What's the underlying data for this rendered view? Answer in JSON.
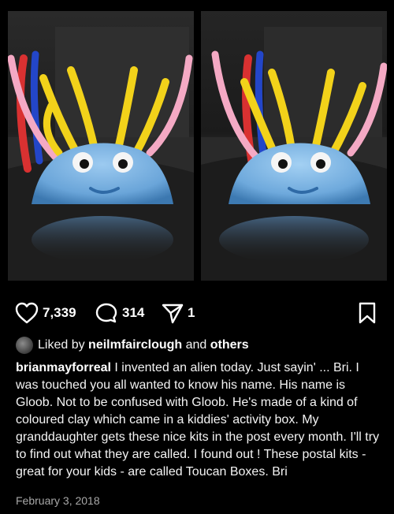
{
  "post": {
    "images": [
      {
        "alt": ""
      },
      {
        "alt": ""
      }
    ],
    "actions": {
      "like_icon": "heart-icon",
      "like_count": "7,339",
      "comment_icon": "comment-bubble-icon",
      "comment_count": "314",
      "share_icon": "send-icon",
      "share_count": "1",
      "save_icon": "bookmark-icon"
    },
    "liked_by": {
      "prefix": "Liked by",
      "user": "neilmfairclough",
      "conjunction": "and",
      "others": "others"
    },
    "caption": {
      "username": "brianmayforreal",
      "text": "I invented an alien today. Just sayin' ... Bri. I was touched you all wanted to know his name. His name is Gloob. Not to be confused with Gloob. He's made of a kind of coloured clay which came in a kiddies' activity box. My granddaughter gets these nice kits in the post every month. I'll try to find out what they are called. I found out ! These postal kits - great for your kids - are called Toucan Boxes. Bri"
    },
    "date": "February 3, 2018"
  },
  "colors": {
    "background": "#000000",
    "text": "#ffffff",
    "muted": "#a8a8a8",
    "clay_blue": "#7fb7e3",
    "pipe_yellow": "#f2d21a",
    "pipe_pink": "#f4a9c4"
  }
}
